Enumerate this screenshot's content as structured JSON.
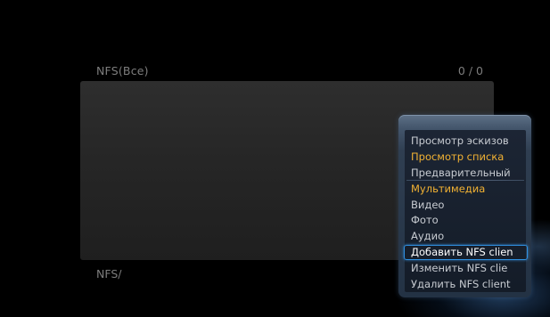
{
  "browser": {
    "title": "NFS(Все)",
    "count": "0 / 0",
    "path": "NFS/"
  },
  "menu": {
    "items": [
      {
        "label": "Просмотр эскизов",
        "highlight": false
      },
      {
        "label": "Просмотр списка",
        "highlight": true
      },
      {
        "label": "Предварительный",
        "highlight": false
      },
      {
        "label": "Мультимедиа",
        "highlight": true
      },
      {
        "label": "Видео",
        "highlight": false
      },
      {
        "label": "Фото",
        "highlight": false
      },
      {
        "label": "Аудио",
        "highlight": false
      },
      {
        "label": "Добавить NFS clien",
        "highlight": false,
        "selected": true
      },
      {
        "label": "Изменить NFS clie",
        "highlight": false
      },
      {
        "label": "Удалить NFS client",
        "highlight": false
      }
    ]
  },
  "colors": {
    "highlight": "#f2b233",
    "selection_border": "#2f8fe0",
    "label": "#7d7d7d"
  }
}
